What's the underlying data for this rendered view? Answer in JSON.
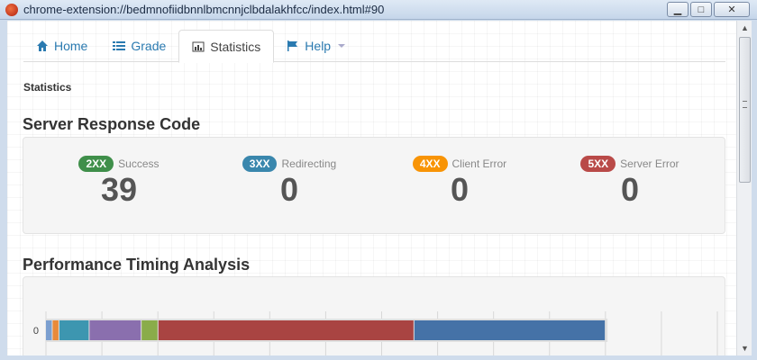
{
  "window": {
    "title": "chrome-extension://bedmnofiidbnnlbmcnnjclbdalakhfcc/index.html#90",
    "minimize_label": "▁",
    "maximize_label": "□",
    "close_label": "✕"
  },
  "tabs": [
    {
      "label": "Home",
      "icon": "home-icon"
    },
    {
      "label": "Grade",
      "icon": "list-icon"
    },
    {
      "label": "Statistics",
      "icon": "bar-chart-icon",
      "active": true
    },
    {
      "label": "Help",
      "icon": "flag-icon",
      "dropdown": true
    }
  ],
  "page": {
    "label": "Statistics",
    "response_title": "Server Response Code",
    "timing_title": "Performance Timing Analysis"
  },
  "response_codes": [
    {
      "code": "2XX",
      "label": "Success",
      "count": "39",
      "color": "#3f8f4a"
    },
    {
      "code": "3XX",
      "label": "Redirecting",
      "count": "0",
      "color": "#3a87ad"
    },
    {
      "code": "4XX",
      "label": "Client Error",
      "count": "0",
      "color": "#f89406"
    },
    {
      "code": "5XX",
      "label": "Server Error",
      "count": "0",
      "color": "#b94a48"
    }
  ],
  "chart_data": {
    "type": "bar",
    "orientation": "horizontal",
    "stacked": true,
    "categories": [
      "0"
    ],
    "xlim": [
      0,
      800
    ],
    "series": [
      {
        "values": [
          8
        ],
        "color": "#7b9fd0"
      },
      {
        "values": [
          8
        ],
        "color": "#e88a3a"
      },
      {
        "values": [
          36
        ],
        "color": "#3d96b0"
      },
      {
        "values": [
          62
        ],
        "color": "#8a6fae"
      },
      {
        "values": [
          20
        ],
        "color": "#8aac4a"
      },
      {
        "values": [
          305
        ],
        "color": "#a94442"
      },
      {
        "values": [
          228
        ],
        "color": "#4572a7"
      }
    ]
  }
}
